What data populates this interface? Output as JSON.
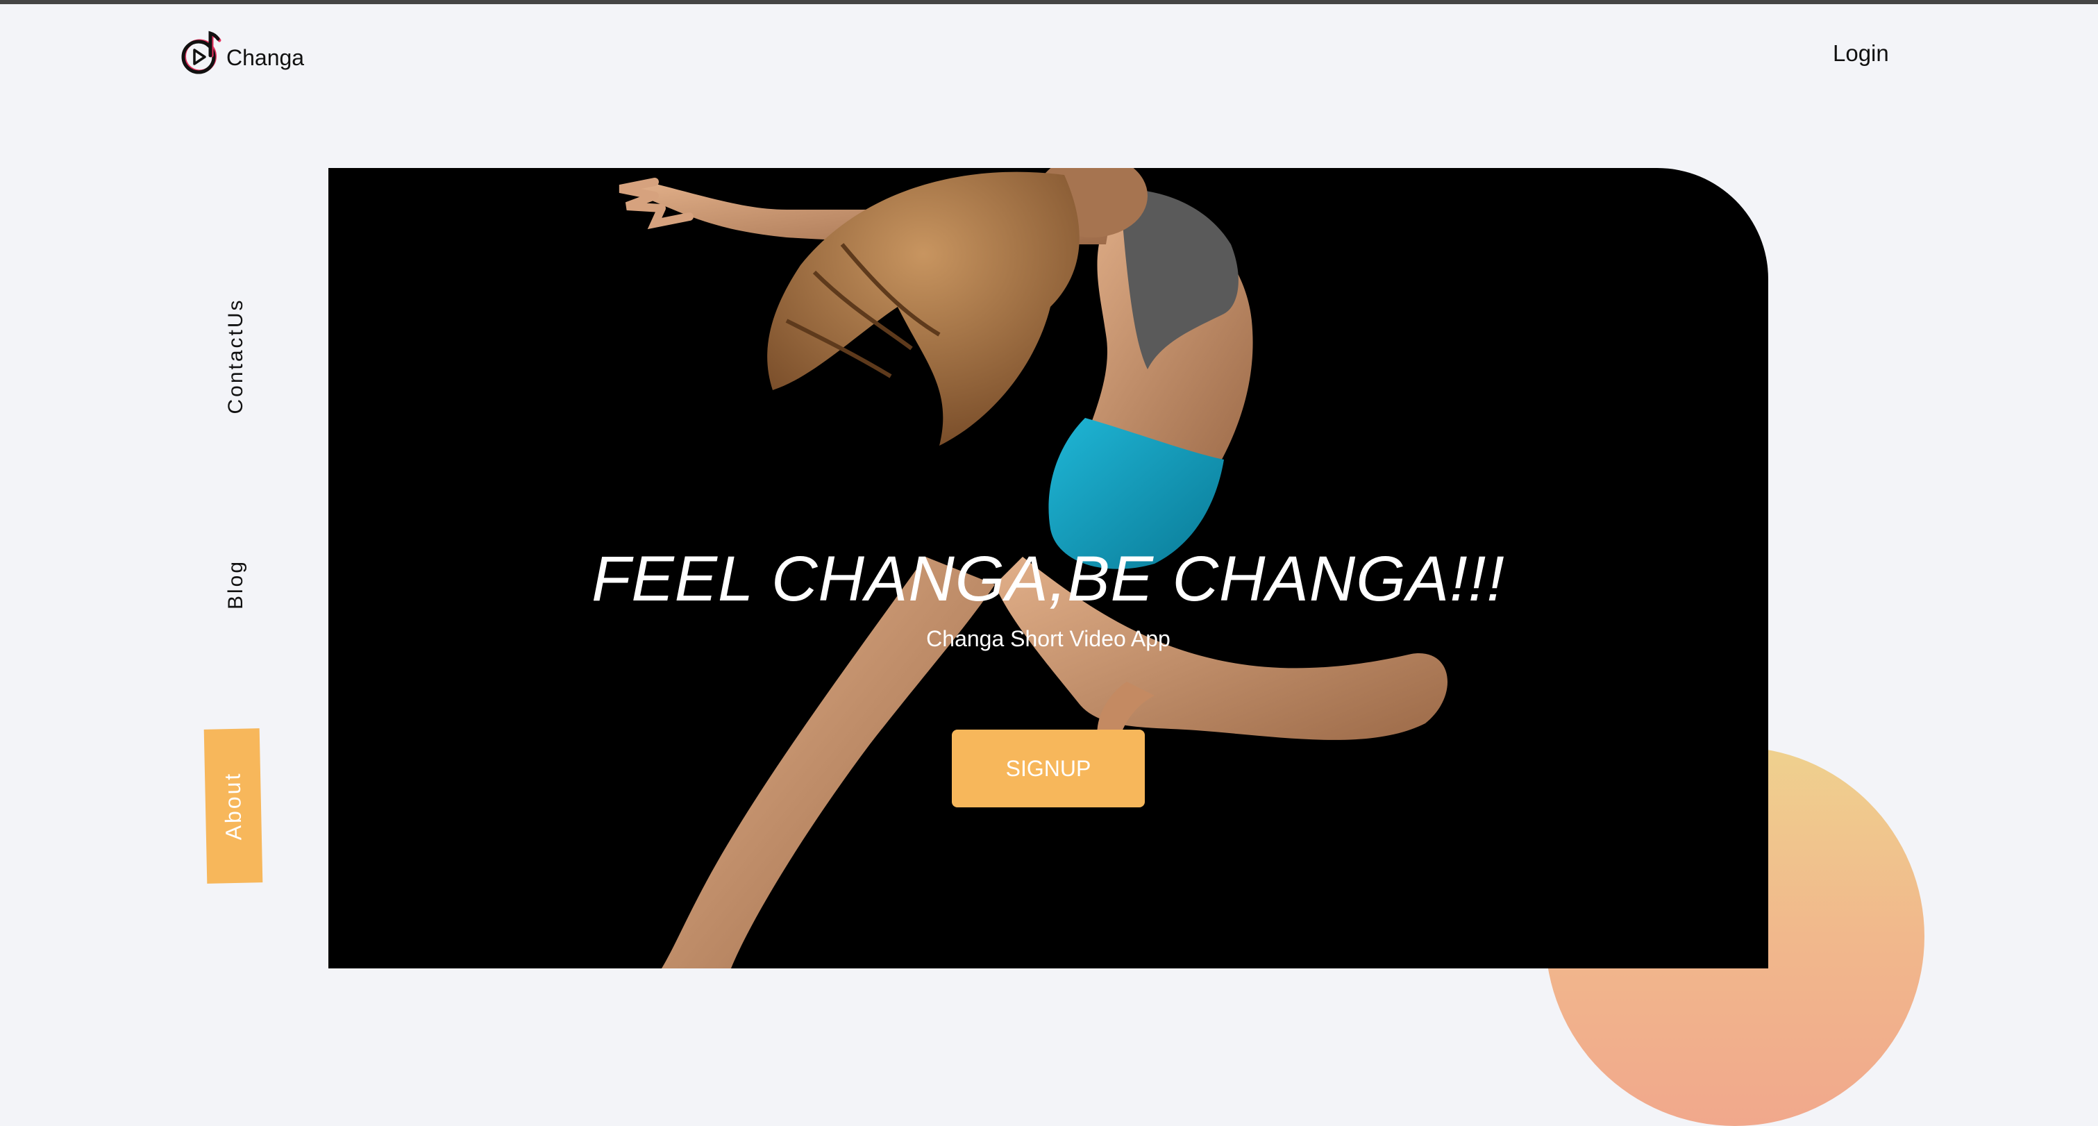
{
  "brand": {
    "name": "Changa",
    "logo_icon": "music-note-play-icon"
  },
  "header": {
    "login_label": "Login"
  },
  "sidenav": {
    "items": [
      {
        "label": "ContactUs"
      },
      {
        "label": "Blog"
      },
      {
        "label": "About",
        "active": true
      }
    ]
  },
  "hero": {
    "heading": "FEEL CHANGA,BE CHANGA!!!",
    "subtitle": "Changa Short Video App",
    "signup_label": "SIGNUP",
    "image": "jumping-dancer-photo"
  },
  "colors": {
    "accent": "#f7b75b",
    "background": "#f3f4f8",
    "hero_background": "#000000",
    "circle_top": "#efd18e",
    "circle_bottom": "#f1a88c"
  }
}
